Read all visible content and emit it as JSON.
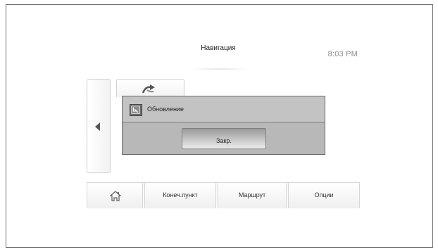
{
  "header": {
    "title": "Навигация",
    "time": "8:03 PM"
  },
  "icons": {
    "back": "chevron-left-icon",
    "tile": "navigation-arrows-icon",
    "dialog": "update-icon",
    "home": "home-icon"
  },
  "dialog": {
    "title": "Обновление",
    "close_label": "Закр."
  },
  "nav": {
    "destination_label": "Конеч.пункт",
    "route_label": "Маршрут",
    "options_label": "Опции"
  },
  "colors": {
    "dialog_background": "#b8b8b8",
    "dialog_header": "#c3c3c3",
    "clock_text": "#8a8a8a"
  }
}
